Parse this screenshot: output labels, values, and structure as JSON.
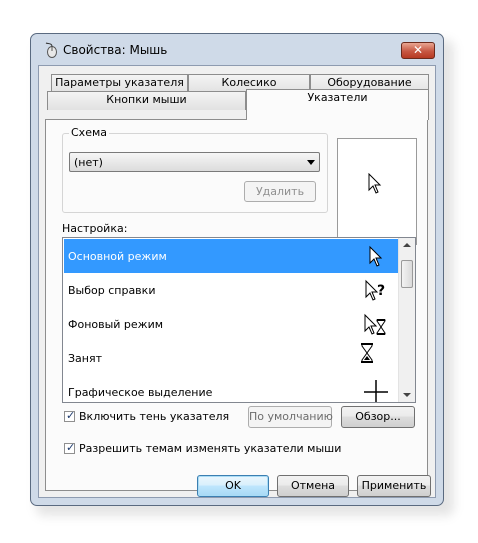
{
  "window": {
    "title": "Свойства: Мышь",
    "icon": "mouse-icon",
    "close_label": "✕"
  },
  "tabs_row_back": [
    {
      "label": "Параметры указателя"
    },
    {
      "label": "Колесико"
    },
    {
      "label": "Оборудование"
    }
  ],
  "tabs_row_front": [
    {
      "label": "Кнопки мыши"
    },
    {
      "label": "Указатели",
      "active": true
    }
  ],
  "scheme": {
    "group_label": "Схема",
    "selected_value": "(нет)",
    "delete_label": "Удалить"
  },
  "customize": {
    "label": "Настройка:",
    "items": [
      {
        "label": "Основной режим",
        "icon": "arrow-pointer-icon",
        "selected": true
      },
      {
        "label": "Выбор справки",
        "icon": "help-select-pointer-icon"
      },
      {
        "label": "Фоновый режим",
        "icon": "working-in-background-pointer-icon"
      },
      {
        "label": "Занят",
        "icon": "busy-hourglass-pointer-icon"
      },
      {
        "label": "Графическое выделение",
        "icon": "precision-crosshair-pointer-icon"
      }
    ]
  },
  "options": {
    "shadow_label": "Включить тень указателя",
    "shadow_checked": true,
    "themes_label": "Разрешить темам изменять указатели мыши",
    "themes_checked": true
  },
  "buttons": {
    "default": "По умолчанию",
    "browse": "Обзор...",
    "ok": "OK",
    "cancel": "Отмена",
    "apply": "Применить"
  },
  "colors": {
    "selection": "#3399ff",
    "window_frame": "#cfdae8"
  }
}
